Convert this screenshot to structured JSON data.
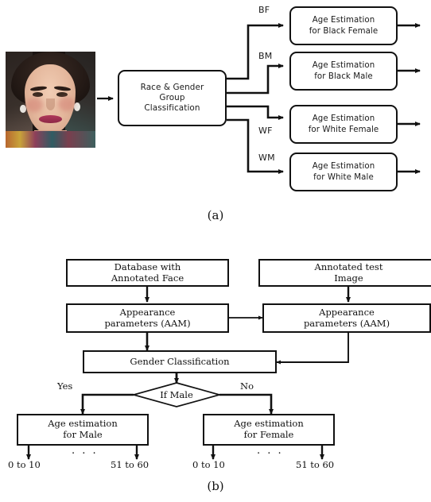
{
  "figure": {
    "panel_a": {
      "label": "(a)",
      "input_image_alt": "face-photo",
      "classifier_box": {
        "lines": [
          "Race & Gender",
          "Group",
          "Classification"
        ]
      },
      "branches": [
        {
          "flag": "BF",
          "lines": [
            "Age Estimation",
            "for Black Female"
          ]
        },
        {
          "flag": "BM",
          "lines": [
            "Age Estimation",
            "for Black Male"
          ]
        },
        {
          "flag": "WF",
          "lines": [
            "Age Estimation",
            "for White Female"
          ]
        },
        {
          "flag": "WM",
          "lines": [
            "Age Estimation",
            "for White Male"
          ]
        }
      ]
    },
    "panel_b": {
      "label": "(b)",
      "boxes": {
        "database": {
          "lines": [
            "Database with",
            "Annotated Face"
          ]
        },
        "test_image": {
          "lines": [
            "Annotated test",
            "Image"
          ]
        },
        "appearance_train": {
          "lines": [
            "Appearance",
            "parameters (AAM)"
          ]
        },
        "appearance_test": {
          "lines": [
            "Appearance",
            "parameters (AAM)"
          ]
        },
        "gender_classification": {
          "lines": [
            "Gender Classification"
          ]
        },
        "age_male": {
          "lines": [
            "Age estimation",
            "for Male"
          ]
        },
        "age_female": {
          "lines": [
            "Age estimation",
            "for Female"
          ]
        }
      },
      "decision": {
        "label": "If Male",
        "yes_label": "Yes",
        "no_label": "No"
      },
      "outputs": {
        "male": {
          "first": "0 to 10",
          "ellipsis": ". . .",
          "last": "51 to 60"
        },
        "female": {
          "first": "0 to 10",
          "ellipsis": ". . .",
          "last": "51 to 60"
        }
      }
    }
  },
  "colors": {
    "stroke": "#111111",
    "background": "#ffffff",
    "text": "#111111"
  }
}
